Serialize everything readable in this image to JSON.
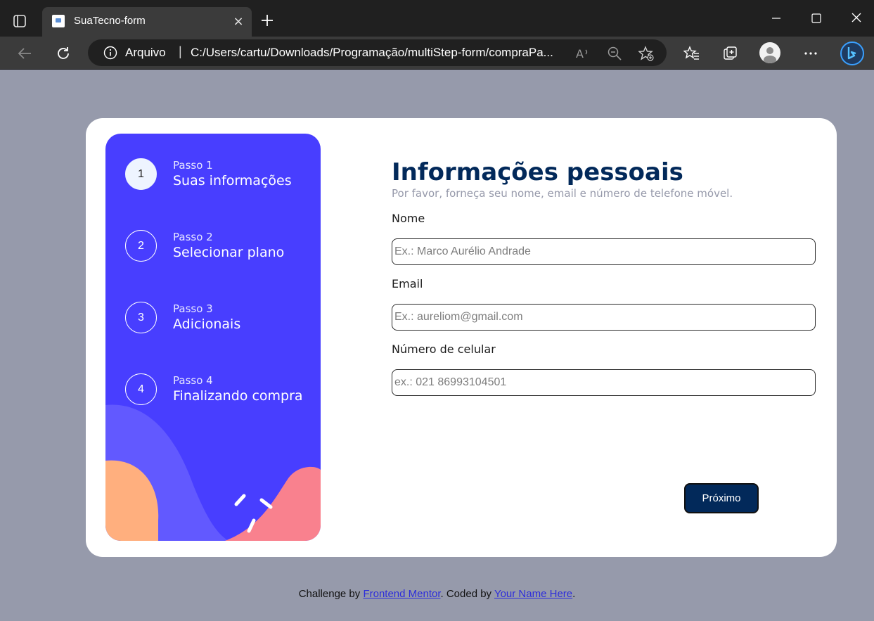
{
  "browser": {
    "tab_title": "SuaTecno-form",
    "address_scheme": "Arquivo",
    "address_separator": "|",
    "url": "C:/Users/cartu/Downloads/Programação/multiStep-form/compraPa..."
  },
  "sidebar": {
    "steps": [
      {
        "number": "1",
        "kicker": "Passo 1",
        "label": "Suas informações",
        "active": true
      },
      {
        "number": "2",
        "kicker": "Passo 2",
        "label": "Selecionar plano",
        "active": false
      },
      {
        "number": "3",
        "kicker": "Passo 3",
        "label": "Adicionais",
        "active": false
      },
      {
        "number": "4",
        "kicker": "Passo 4",
        "label": "Finalizando compra",
        "active": false
      }
    ]
  },
  "form": {
    "title": "Informações pessoais",
    "subtitle": "Por favor, forneça seu nome, email e número de telefone móvel.",
    "fields": [
      {
        "label": "Nome",
        "placeholder": "Ex.: Marco Aurélio Andrade",
        "value": ""
      },
      {
        "label": "Email",
        "placeholder": "Ex.: aureliom@gmail.com",
        "value": ""
      },
      {
        "label": "Número de celular",
        "placeholder": "ex.: 021 86993104501",
        "value": ""
      }
    ],
    "next_label": "Próximo"
  },
  "attribution": {
    "prefix": "Challenge by ",
    "link1": "Frontend Mentor",
    "middle": ". Coded by ",
    "link2": "Your Name Here",
    "suffix": "."
  },
  "colors": {
    "sidebar_bg": "#483eff",
    "title": "#02295a",
    "button_bg": "#02295a",
    "page_bg": "#969aab"
  }
}
